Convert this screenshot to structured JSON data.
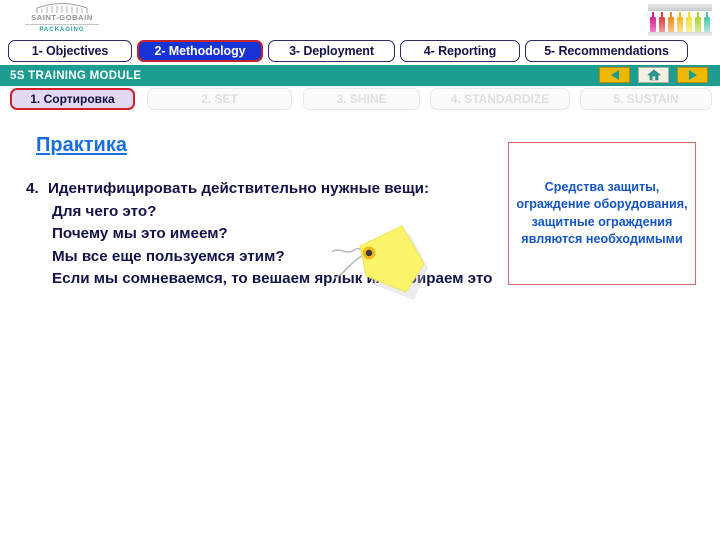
{
  "brand": {
    "name": "SAINT-GOBAIN",
    "sub": "PACKAGING",
    "logo_icon": "saint-gobain-arch-icon",
    "product_icon": "bottles-row-icon",
    "teal": "#1d9c90",
    "bottle_colors": [
      "#d6219a",
      "#e23b3b",
      "#f08a1e",
      "#f4b41a",
      "#f2de2a",
      "#a9d62b",
      "#4cc6a8"
    ]
  },
  "top_tabs": [
    {
      "label": "1- Objectives",
      "active": false
    },
    {
      "label": "2- Methodology",
      "active": true
    },
    {
      "label": "3- Deployment",
      "active": false
    },
    {
      "label": "4- Reporting",
      "active": false
    },
    {
      "label": "5- Recommendations",
      "active": false
    }
  ],
  "banner": {
    "title": "5S TRAINING MODULE",
    "buttons": [
      {
        "icon": "previous-arrow-icon",
        "name": "previous-button"
      },
      {
        "icon": "home-icon",
        "name": "home-button"
      },
      {
        "icon": "next-arrow-icon",
        "name": "next-button"
      }
    ]
  },
  "step_tabs": [
    {
      "label": "1. Сортировка",
      "active": true
    },
    {
      "label": "2. SET",
      "active": false
    },
    {
      "label": "3. SHINE",
      "active": false
    },
    {
      "label": "4. STANDARDIZE",
      "active": false
    },
    {
      "label": "5. SUSTAIN",
      "active": false
    }
  ],
  "content": {
    "heading": "Практика",
    "item_number": "4.",
    "item_text": "Идентифицировать действительно  нужные вещи:",
    "questions": [
      "Для чего это?",
      "Почему мы это имеем?",
      "Мы все еще пользуемся этим?",
      "Если мы сомневаемся, то вешаем ярлык или убираем это"
    ],
    "tag_icon": "yellow-tag-icon"
  },
  "callout": {
    "text": "Средства защиты, ограждение оборудования, защитные ограждения являются необходимыми",
    "border_color": "#d9676c",
    "text_color": "#1555c8"
  }
}
